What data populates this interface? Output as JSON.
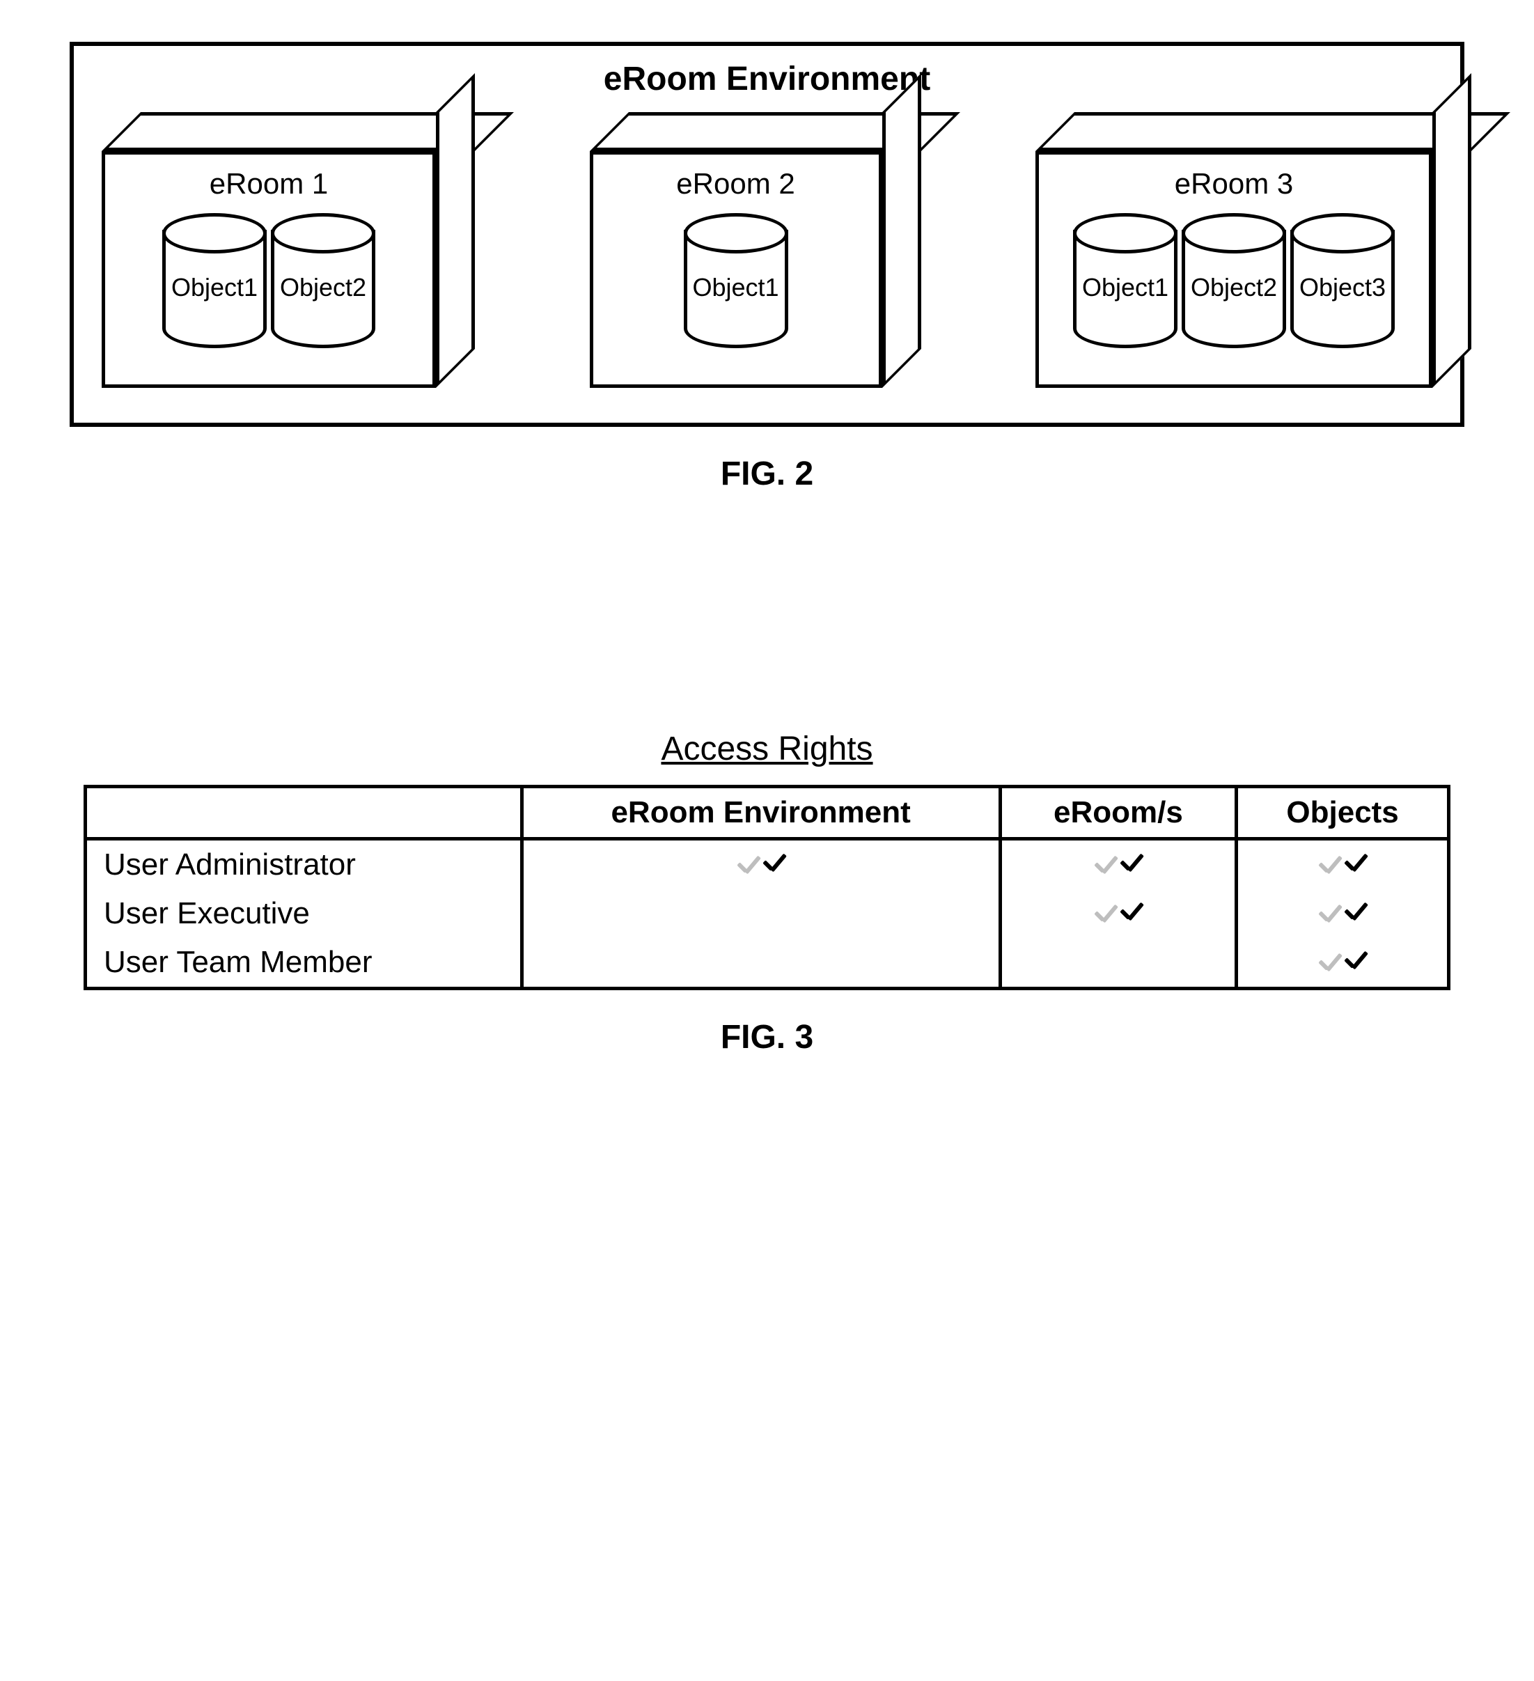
{
  "fig2": {
    "env_title": "eRoom Environment",
    "rooms": [
      {
        "label": "eRoom 1",
        "objects": [
          "Object1",
          "Object2"
        ]
      },
      {
        "label": "eRoom 2",
        "objects": [
          "Object1"
        ]
      },
      {
        "label": "eRoom 3",
        "objects": [
          "Object1",
          "Object2",
          "Object3"
        ]
      }
    ],
    "caption": "FIG. 2"
  },
  "fig3": {
    "title": "Access Rights",
    "columns": [
      "",
      "eRoom Environment",
      "eRoom/s",
      "Objects"
    ],
    "rows": [
      {
        "label": "User Administrator",
        "cells": [
          true,
          true,
          true
        ]
      },
      {
        "label": "User Executive",
        "cells": [
          false,
          true,
          true
        ]
      },
      {
        "label": "User Team Member",
        "cells": [
          false,
          false,
          true
        ]
      }
    ],
    "caption": "FIG. 3"
  }
}
